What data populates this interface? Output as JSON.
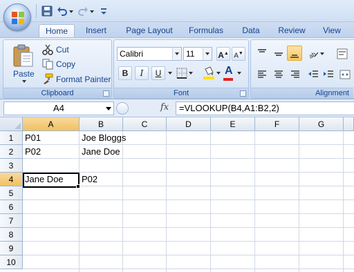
{
  "quick_access": {
    "icons": [
      "save-icon",
      "undo-icon",
      "redo-icon",
      "customize-qat-icon"
    ]
  },
  "tabs": [
    {
      "label": "Home",
      "active": true
    },
    {
      "label": "Insert"
    },
    {
      "label": "Page Layout"
    },
    {
      "label": "Formulas"
    },
    {
      "label": "Data"
    },
    {
      "label": "Review"
    },
    {
      "label": "View"
    }
  ],
  "ribbon": {
    "clipboard": {
      "label": "Clipboard",
      "paste": "Paste",
      "cut": "Cut",
      "copy": "Copy",
      "format_painter": "Format Painter"
    },
    "font": {
      "label": "Font",
      "font_name": "Calibri",
      "font_size": "11",
      "bold": "B",
      "italic": "I",
      "underline": "U",
      "font_color_letter": "A",
      "fill_color": "#ffe200",
      "font_color": "#e02020"
    },
    "alignment": {
      "label": "Alignment"
    }
  },
  "formula_bar": {
    "name_box": "A4",
    "fx": "fx",
    "formula": "=VLOOKUP(B4,A1:B2,2)"
  },
  "grid": {
    "columns": [
      "A",
      "B",
      "C",
      "D",
      "E",
      "F",
      "G"
    ],
    "rows": [
      "1",
      "2",
      "3",
      "4",
      "5",
      "6",
      "7",
      "8",
      "9",
      "10"
    ],
    "selected_column": "A",
    "selected_row": "4",
    "cells": {
      "A1": "P01",
      "B1": "Joe Bloggs",
      "A2": "P02",
      "B2": "Jane Doe",
      "A4": "Jane Doe",
      "B4": "P02"
    }
  }
}
